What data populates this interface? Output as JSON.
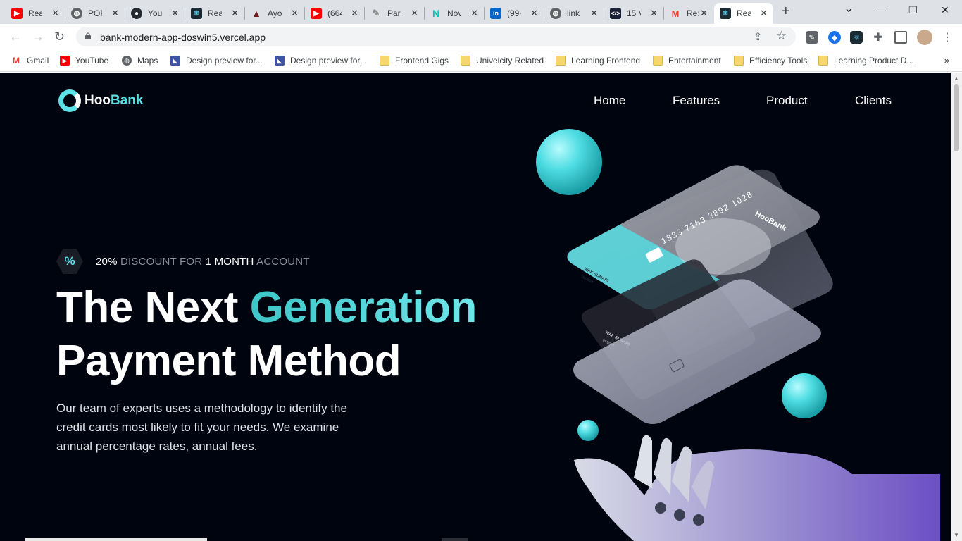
{
  "browser": {
    "tabs": [
      {
        "label": "Rea",
        "favicon": "youtube-icon",
        "color": "#ff0000"
      },
      {
        "label": "POF",
        "favicon": "globe-icon",
        "color": "#5f6368"
      },
      {
        "label": "You",
        "favicon": "github-icon",
        "color": "#24292f"
      },
      {
        "label": "Rea",
        "favicon": "react-icon",
        "color": "#149eca"
      },
      {
        "label": "Ayo",
        "favicon": "ayo-logo-icon",
        "color": "#6b1c1c"
      },
      {
        "label": "(664",
        "favicon": "youtube-icon",
        "color": "#ff0000"
      },
      {
        "label": "Para",
        "favicon": "feather-icon",
        "color": "#8a8a8a"
      },
      {
        "label": "Nov",
        "favicon": "n-logo-icon",
        "color": "#00c4b4"
      },
      {
        "label": "(99+",
        "favicon": "linkedin-icon",
        "color": "#0a66c2"
      },
      {
        "label": "link",
        "favicon": "globe-icon",
        "color": "#5f6368"
      },
      {
        "label": "15 V",
        "favicon": "code-icon",
        "color": "#1b2236"
      },
      {
        "label": "Re:",
        "favicon": "gmail-icon",
        "color": "#ea4335"
      },
      {
        "label": "Rea",
        "favicon": "react-icon",
        "color": "#149eca"
      }
    ],
    "active_tab_index": 12,
    "close_glyph": "✕",
    "new_tab_glyph": "+",
    "window": {
      "chevron": "⌄",
      "minimize": "—",
      "restore": "❐",
      "close": "✕"
    },
    "nav": {
      "back": "←",
      "forward": "→",
      "reload": "↻"
    },
    "url": "bank-modern-app-doswin5.vercel.app",
    "omnibox_icons": {
      "share": "⇪",
      "star": "☆"
    },
    "bookmarks": [
      {
        "label": "Gmail",
        "icon": "gmail-icon"
      },
      {
        "label": "YouTube",
        "icon": "youtube-icon"
      },
      {
        "label": "Maps",
        "icon": "maps-icon"
      },
      {
        "label": "Design preview for...",
        "icon": "frontend-mentor-icon"
      },
      {
        "label": "Design preview for...",
        "icon": "frontend-mentor-icon"
      },
      {
        "label": "Frontend Gigs",
        "icon": "folder-icon"
      },
      {
        "label": "Univelcity Related",
        "icon": "folder-icon"
      },
      {
        "label": "Learning Frontend",
        "icon": "folder-icon"
      },
      {
        "label": "Entertainment",
        "icon": "folder-icon"
      },
      {
        "label": "Efficiency Tools",
        "icon": "folder-icon"
      },
      {
        "label": "Learning Product D...",
        "icon": "folder-icon"
      }
    ],
    "bookmarks_more": "»"
  },
  "page": {
    "logo": {
      "part1": "Hoo",
      "part2": "Bank"
    },
    "nav": [
      "Home",
      "Features",
      "Product",
      "Clients"
    ],
    "promo": {
      "badge": "%",
      "percent": "20%",
      "mid": "DISCOUNT FOR",
      "duration": "1 MONTH",
      "tail": "ACCOUNT"
    },
    "headline": {
      "line1_a": "The Next",
      "line1_b": "Generation",
      "line2": "Payment Method"
    },
    "description": "Our team of experts uses a methodology to identify the credit cards most likely to fit your needs. We examine annual percentage rates, annual fees.",
    "card": {
      "number": "1833 7163 3892 1028",
      "brand": "HooBank",
      "holder": "WAK SUNARI",
      "expiry": "09/2024"
    },
    "colors": {
      "background": "#00040f",
      "accent": "#5ce1e6",
      "text": "#ffffff",
      "muted": "#8a8f9c"
    }
  }
}
